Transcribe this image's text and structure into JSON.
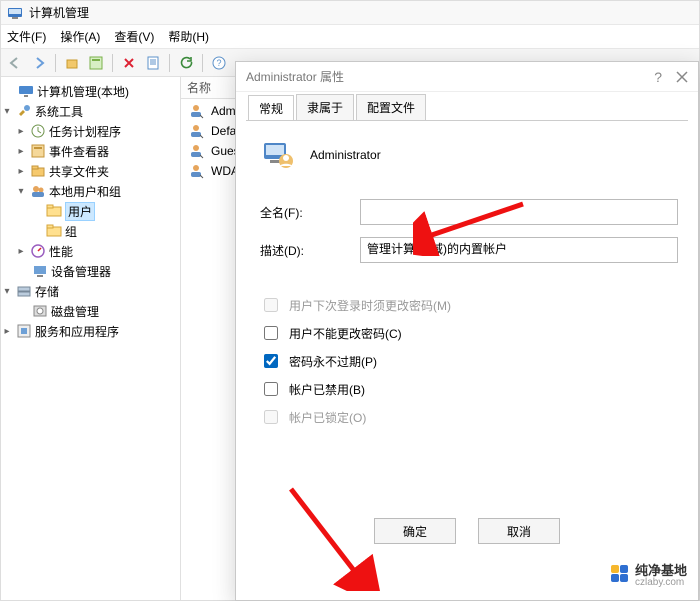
{
  "window": {
    "title": "计算机管理"
  },
  "menu": [
    "文件(F)",
    "操作(A)",
    "查看(V)",
    "帮助(H)"
  ],
  "tree": {
    "root": "计算机管理(本地)",
    "nodes": [
      {
        "label": "系统工具",
        "expanded": true,
        "children": [
          {
            "label": "任务计划程序",
            "icon": "clock"
          },
          {
            "label": "事件查看器",
            "icon": "event"
          },
          {
            "label": "共享文件夹",
            "icon": "share"
          },
          {
            "label": "本地用户和组",
            "icon": "users",
            "expanded": true,
            "children": [
              {
                "label": "用户",
                "icon": "folder",
                "selected": true
              },
              {
                "label": "组",
                "icon": "folder"
              }
            ]
          },
          {
            "label": "性能",
            "icon": "perf"
          },
          {
            "label": "设备管理器",
            "icon": "device"
          }
        ]
      },
      {
        "label": "存储",
        "expanded": true,
        "children": [
          {
            "label": "磁盘管理",
            "icon": "disk"
          }
        ]
      },
      {
        "label": "服务和应用程序",
        "expanded": false,
        "icon": "svc"
      }
    ]
  },
  "list": {
    "header": "名称",
    "items": [
      {
        "label": "Admini",
        "icon": "userdown"
      },
      {
        "label": "Defau",
        "icon": "userdown"
      },
      {
        "label": "Gues",
        "icon": "userdown"
      },
      {
        "label": "WDA",
        "icon": "userdown"
      }
    ]
  },
  "dialog": {
    "title": "Administrator 属性",
    "help": "?",
    "tabs": [
      "常规",
      "隶属于",
      "配置文件"
    ],
    "active_tab": 0,
    "user_name": "Administrator",
    "full_name_label": "全名(F):",
    "full_name_value": "     ",
    "desc_label": "描述(D):",
    "desc_value": "管理计算机(域)的内置帐户",
    "checks": [
      {
        "label": "用户下次登录时须更改密码(M)",
        "checked": false,
        "disabled": true
      },
      {
        "label": "用户不能更改密码(C)",
        "checked": false,
        "disabled": false
      },
      {
        "label": "密码永不过期(P)",
        "checked": true,
        "disabled": false
      },
      {
        "label": "帐户已禁用(B)",
        "checked": false,
        "disabled": false
      },
      {
        "label": "帐户已锁定(O)",
        "checked": false,
        "disabled": true
      }
    ],
    "buttons": {
      "ok": "确定",
      "cancel": "取消"
    }
  },
  "watermark": {
    "brand": "纯净基地",
    "url": "czlaby.com"
  }
}
